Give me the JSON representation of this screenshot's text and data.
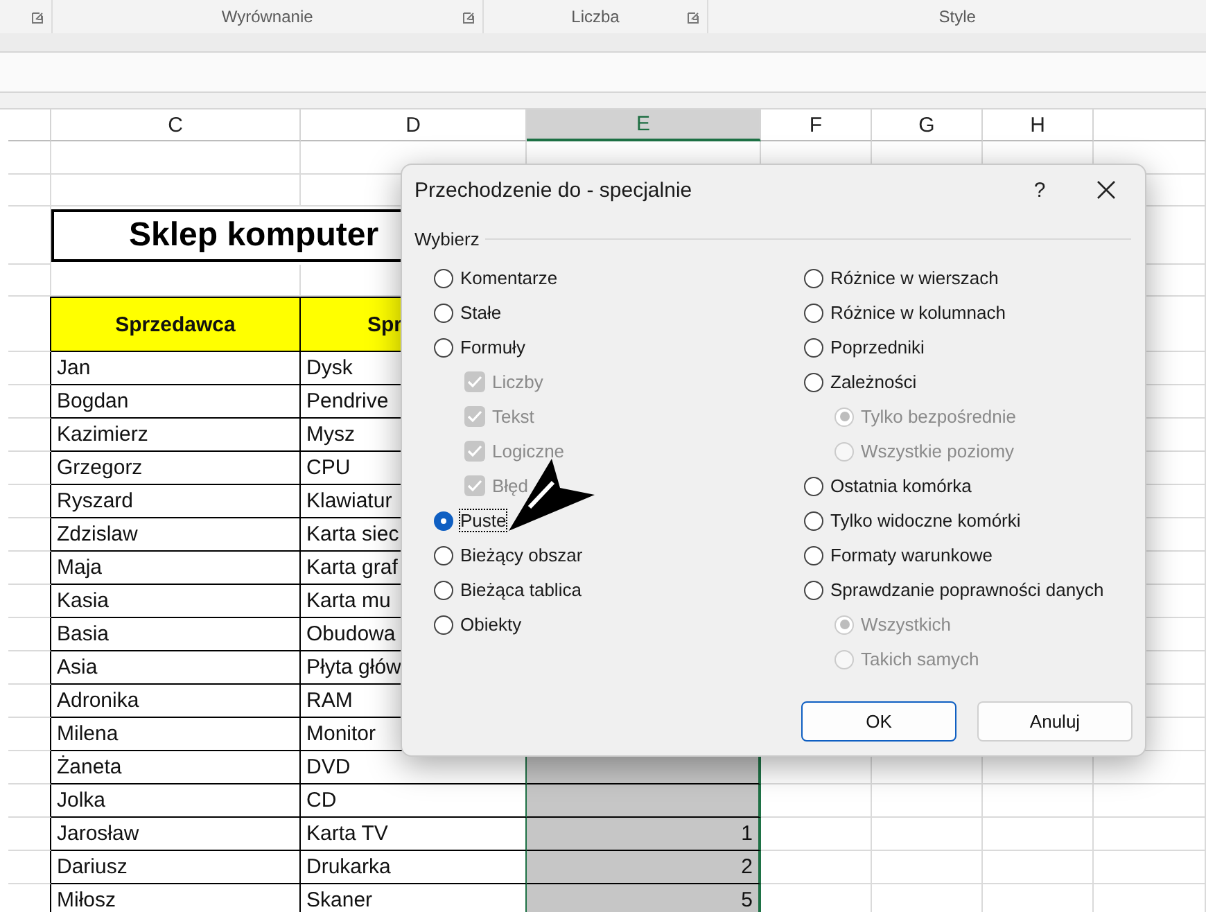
{
  "ribbon_groups": [
    {
      "launcher": true
    },
    {
      "label": "Wyrównanie",
      "launcher": true
    },
    {
      "label": "Liczba",
      "launcher": true
    },
    {
      "label": "Style",
      "launcher": false
    }
  ],
  "column_headers": [
    {
      "label": "C",
      "selected": false
    },
    {
      "label": "D",
      "selected": false
    },
    {
      "label": "E",
      "selected": true
    },
    {
      "label": "F",
      "selected": false
    },
    {
      "label": "G",
      "selected": false
    },
    {
      "label": "H",
      "selected": false
    }
  ],
  "sheet": {
    "title": "Sklep komputer",
    "headers": [
      "Sprzedawca",
      "Spr"
    ],
    "rows": [
      {
        "seller": "Jan",
        "product": "Dysk"
      },
      {
        "seller": "Bogdan",
        "product": "Pendrive"
      },
      {
        "seller": "Kazimierz",
        "product": "Mysz"
      },
      {
        "seller": "Grzegorz",
        "product": "CPU"
      },
      {
        "seller": "Ryszard",
        "product": "Klawiatur"
      },
      {
        "seller": "Zdzislaw",
        "product": "Karta siec"
      },
      {
        "seller": "Maja",
        "product": "Karta graf"
      },
      {
        "seller": "Kasia",
        "product": "Karta mu"
      },
      {
        "seller": "Basia",
        "product": "Obudowa"
      },
      {
        "seller": "Asia",
        "product": "Płyta głów"
      },
      {
        "seller": "Adronika",
        "product": "RAM"
      },
      {
        "seller": "Milena",
        "product": "Monitor"
      },
      {
        "seller": "Żaneta",
        "product": "DVD"
      },
      {
        "seller": "Jolka",
        "product": "CD"
      },
      {
        "seller": "Jarosław",
        "product": "Karta TV",
        "value": "1"
      },
      {
        "seller": "Dariusz",
        "product": "Drukarka",
        "value": "2"
      },
      {
        "seller": "Miłosz",
        "product": "Skaner",
        "value": "5"
      }
    ]
  },
  "dialog": {
    "title": "Przechodzenie do - specjalnie",
    "help": "?",
    "group_label": "Wybierz",
    "left_options": [
      {
        "label": "Komentarze",
        "selected": false
      },
      {
        "label": "Stałe",
        "selected": false
      },
      {
        "label": "Formuły",
        "selected": false,
        "children": [
          {
            "label": "Liczby",
            "checked": true,
            "disabled": true
          },
          {
            "label": "Tekst",
            "checked": true,
            "disabled": true
          },
          {
            "label": "Logiczne",
            "checked": true,
            "disabled": true
          },
          {
            "label": "Błęd",
            "checked": true,
            "disabled": true
          }
        ]
      },
      {
        "label": "Puste",
        "selected": true,
        "focused": true
      },
      {
        "label": "Bieżący obszar",
        "selected": false
      },
      {
        "label": "Bieżąca tablica",
        "selected": false
      },
      {
        "label": "Obiekty",
        "selected": false
      }
    ],
    "right_options": [
      {
        "label": "Różnice w wierszach",
        "selected": false
      },
      {
        "label": "Różnice w kolumnach",
        "selected": false
      },
      {
        "label": "Poprzedniki",
        "selected": false
      },
      {
        "label": "Zależności",
        "selected": false,
        "sub_options": [
          {
            "label": "Tylko bezpośrednie",
            "selected": true,
            "disabled": true
          },
          {
            "label": "Wszystkie poziomy",
            "selected": false,
            "disabled": true
          }
        ]
      },
      {
        "label": "Ostatnia komórka",
        "selected": false
      },
      {
        "label": "Tylko widoczne komórki",
        "selected": false
      },
      {
        "label": "Formaty warunkowe",
        "selected": false
      },
      {
        "label": "Sprawdzanie poprawności danych",
        "selected": false,
        "sub_options": [
          {
            "label": "Wszystkich",
            "selected": true,
            "disabled": true
          },
          {
            "label": "Takich samych",
            "selected": false,
            "disabled": true
          }
        ]
      }
    ],
    "buttons": [
      {
        "label": "OK",
        "default": true
      },
      {
        "label": "Anuluj",
        "default": false
      }
    ]
  }
}
